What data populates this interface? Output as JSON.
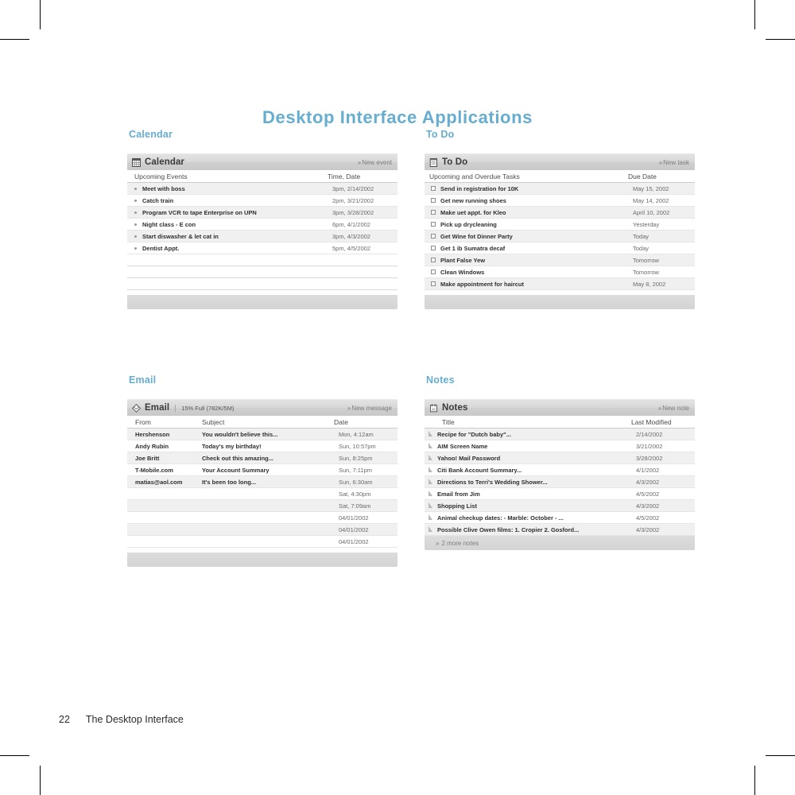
{
  "page": {
    "title": "Desktop Interface Applications",
    "footer_page_number": "22",
    "footer_chapter": "The Desktop Interface",
    "accent_color": "#66ADD0",
    "titlebar_color": "#d4d4d4",
    "row_alt_color": "#f0f0f0"
  },
  "calendar": {
    "section_label": "Calendar",
    "app_name": "Calendar",
    "icon": "calendar-grid-icon",
    "action_label": "New event",
    "action_chevron": "»",
    "columns": [
      "Upcoming Events",
      "Time, Date"
    ],
    "rows": [
      {
        "title": "Meet with boss",
        "when": "3pm, 2/14/2002"
      },
      {
        "title": "Catch train",
        "when": "2pm, 3/21/2002"
      },
      {
        "title": "Program VCR to tape Enterprise on UPN",
        "when": "3pm, 3/28/2002"
      },
      {
        "title": "Night class - E con",
        "when": "6pm, 4/1/2002"
      },
      {
        "title": "Start diswasher & let cat in",
        "when": "3pm, 4/3/2002"
      },
      {
        "title": "Dentist Appt.",
        "when": "5pm, 4/5/2002"
      },
      {
        "title": "",
        "when": ""
      },
      {
        "title": "",
        "when": ""
      },
      {
        "title": "",
        "when": ""
      }
    ]
  },
  "todo": {
    "section_label": "To Do",
    "app_name": "To Do",
    "icon": "checklist-page-icon",
    "action_label": "New task",
    "action_chevron": "»",
    "columns": [
      "Upcoming and Overdue Tasks",
      "Due Date"
    ],
    "rows": [
      {
        "title": "Send in registration for 10K",
        "due": "May 15, 2002"
      },
      {
        "title": "Get new running shoes",
        "due": "May 14, 2002"
      },
      {
        "title": "Make uet appt. for Kleo",
        "due": "April 10, 2002"
      },
      {
        "title": "Pick up drycleaning",
        "due": "Yesterday"
      },
      {
        "title": "Get Wine fot Dinner Party",
        "due": "Today"
      },
      {
        "title": "Get 1 ib Sumatra decaf",
        "due": "Today"
      },
      {
        "title": "Plant False Yew",
        "due": "Tomorrow"
      },
      {
        "title": "Clean Windows",
        "due": "Tomorrow"
      },
      {
        "title": "Make appointment for haircut",
        "due": "May 8, 2002"
      }
    ]
  },
  "email": {
    "section_label": "Email",
    "app_name": "Email",
    "icon": "envelope-diamond-icon",
    "meta": "15% Full (782K/5M)",
    "action_label": "New message",
    "action_chevron": "»",
    "columns": [
      "From",
      "Subject",
      "Date"
    ],
    "rows": [
      {
        "from": "Hershenson",
        "subject": "You wouldn't believe this...",
        "date": "Mon, 4:12am"
      },
      {
        "from": "Andy Rubin",
        "subject": "Today's my birthday!",
        "date": "Sun, 10:57pm"
      },
      {
        "from": "Joe Britt",
        "subject": "Check out this amazing...",
        "date": "Sun, 8:25pm"
      },
      {
        "from": "T-Mobile.com",
        "subject": "Your Account Summary",
        "date": "Sun, 7:11pm"
      },
      {
        "from": "matias@aol.com",
        "subject": "It's been too long...",
        "date": "Sun, 6:30am"
      },
      {
        "from": "",
        "subject": "",
        "date": "Sat, 4:30pm"
      },
      {
        "from": "",
        "subject": "",
        "date": "Sat, 7:09am"
      },
      {
        "from": "",
        "subject": "",
        "date": "04/01/2002"
      },
      {
        "from": "",
        "subject": "",
        "date": "04/01/2002"
      },
      {
        "from": "",
        "subject": "",
        "date": "04/01/2002"
      }
    ]
  },
  "notes": {
    "section_label": "Notes",
    "app_name": "Notes",
    "icon": "note-clip-icon",
    "action_label": "New note",
    "action_chevron": "»",
    "columns": [
      "Title",
      "Last Modified"
    ],
    "rows": [
      {
        "title": "Recipe for  \"Dutch baby\"...",
        "modified": "2/14/2002"
      },
      {
        "title": "AIM Screen Name",
        "modified": "3/21/2002"
      },
      {
        "title": "Yahoo! Mail Password",
        "modified": "3/28/2002"
      },
      {
        "title": "Citi Bank Account Summary...",
        "modified": "4/1/2002"
      },
      {
        "title": "Directions to Terri's Wedding Shower...",
        "modified": "4/3/2002"
      },
      {
        "title": "Email from Jim",
        "modified": "4/5/2002"
      },
      {
        "title": "Shopping List",
        "modified": "4/3/2002"
      },
      {
        "title": "Animal checkup dates: - Marble: October - ...",
        "modified": "4/5/2002"
      },
      {
        "title": "Possible Clive Owen films: 1. Cropier  2. Gosford...",
        "modified": "4/3/2002"
      }
    ],
    "footer_label": "2 more notes",
    "footer_chevron": "»"
  }
}
